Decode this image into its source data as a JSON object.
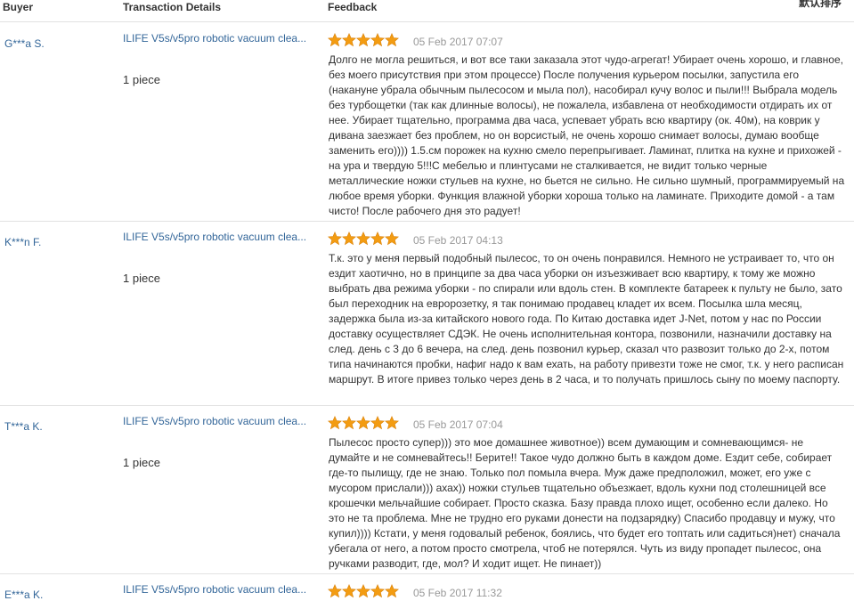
{
  "header": {
    "buyer": "Buyer",
    "transaction": "Transaction Details",
    "feedback": "Feedback",
    "sort": "默认排序"
  },
  "colors": {
    "link": "#336699",
    "star": "#f39c12",
    "date": "#999999",
    "divider": "#e2e2e2"
  },
  "reviews": [
    {
      "buyer": "G***a S.",
      "product": "ILIFE V5s/v5pro robotic vacuum clea...",
      "qty": "1 piece",
      "rating": 5,
      "date": "05 Feb 2017 07:07",
      "text": "Долго не могла решиться, и вот все таки заказала этот чудо-агрегат! Убирает очень хорошо, и главное, без моего присутствия при этом процессе) После получения курьером посылки, запустила его (накануне убрала обычным пылесосом и мыла пол), насобирал кучу волос и пыли!!! Выбрала модель без турбощетки (так как длинные волосы), не пожалела, избавлена от необходимости отдирать их от нее. Убирает тщательно, программа два часа, успевает убрать всю квартиру (ок. 40м), на коврик у дивана заезжает без проблем, но он ворсистый, не очень хорошо снимает волосы, думаю вообще заменить его)))) 1.5.см порожек на кухню смело перепрыгивает. Ламинат, плитка на кухне и прихожей - на ура и твердую 5!!!С мебелью и плинтусами не сталкивается, не видит только черные металлические ножки стульев на кухне, но бьется не сильно. Не сильно шумный, программируемый на любое время уборки. Функция влажной уборки хороша только на ламинате. Приходите домой - а там чисто! После рабочего дня это радует!"
    },
    {
      "buyer": "K***n F.",
      "product": "ILIFE V5s/v5pro robotic vacuum clea...",
      "qty": "1 piece",
      "rating": 5,
      "date": "05 Feb 2017 04:13",
      "text": "Т.к. это у меня первый подобный пылесос, то он очень понравился. Немного не устраивает то, что он ездит хаотично, но в принципе за два часа уборки он изъезживает всю квартиру, к тому же можно выбрать два режима уборки - по спирали или вдоль стен. В комплекте батареек к пульту не было, зато был переходник на евророзетку, я так понимаю продавец кладет их всем. Посылка шла месяц, задержка была из-за китайского нового года. По Китаю доставка идет J-Net, потом у нас по России доставку осуществляет СДЭК. Не очень исполнительная контора, позвонили, назначили доставку на след. день с 3 до 6 вечера, на след. день позвонил курьер, сказал что развозит только до 2-х, потом типа начинаются пробки, нафиг надо к вам ехать, на работу привезти тоже не смог, т.к. у него расписан маршрут. В итоге привез только через день в 2 часа, и то получать пришлось сыну по моему паспорту."
    },
    {
      "buyer": "T***a K.",
      "product": "ILIFE V5s/v5pro robotic vacuum clea...",
      "qty": "1 piece",
      "rating": 5,
      "date": "05 Feb 2017 07:04",
      "text": "Пылесос просто супер))) это мое домашнее животное)) всем думающим и сомневающимся- не думайте и не сомневайтесь!! Берите!! Такое чудо должно быть в каждом доме. Ездит себе, собирает где-то пылищу, где не знаю. Только пол помыла вчера. Муж даже предположил, может, его уже с мусором прислали))) ахах)) ножки стульев тщательно объезжает, вдоль кухни под столешницей все крошечки мельчайшие собирает. Просто сказка. Базу правда плохо ищет, особенно если далеко. Но это не та проблема. Мне не трудно его руками донести на подзарядку) Спасибо продавцу и мужу, что купил)))) Кстати, у меня годовалый ребенок, боялись, что будет его топтать или садиться)нет) сначала убегала от него, а потом просто смотрела, чтоб не потерялся. Чуть из виду пропадет пылесос, она ручками разводит, где, мол? И ходит ищет. Не пинает))"
    },
    {
      "buyer": "E***a K.",
      "product": "ILIFE V5s/v5pro robotic vacuum clea...",
      "qty": "",
      "rating": 5,
      "date": "05 Feb 2017 11:32",
      "text": ""
    }
  ]
}
